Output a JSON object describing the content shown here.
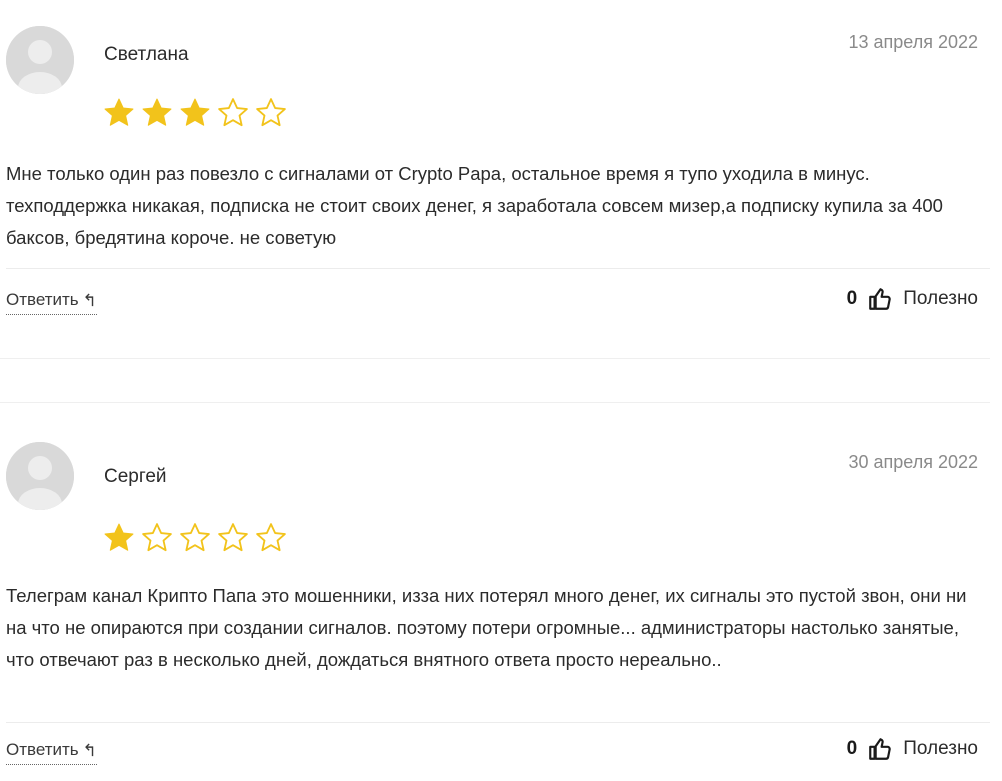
{
  "reviews": [
    {
      "author": "Светлана",
      "date": "13 апреля 2022",
      "rating": 3,
      "max_rating": 5,
      "text": "Мне только один раз повезло с сигналами от Crypto Papa, остальное время я тупо уходила в минус. техподдержка никакая, подписка не стоит своих денег, я заработала совсем мизер,а подписку купила за 400 баксов, бредятина короче. не советую",
      "reply_label": "Ответить",
      "helpful_count": "0",
      "helpful_label": "Полезно"
    },
    {
      "author": "Сергей",
      "date": "30 апреля 2022",
      "rating": 1,
      "max_rating": 5,
      "text": "Телеграм канал Крипто Папа это мошенники, изза них потерял много денег, их сигналы это пустой звон, они ни на что не опираются при создании сигналов. поэтому потери огромные... администраторы настолько занятые, что отвечают раз в несколько дней, дождаться внятного ответа просто нереально..",
      "reply_label": "Ответить",
      "helpful_count": "0",
      "helpful_label": "Полезно"
    }
  ],
  "icons": {
    "avatar": "user-avatar-placeholder-icon",
    "star_filled": "star-filled-icon",
    "star_empty": "star-outline-icon",
    "reply": "reply-arrow-icon",
    "thumb": "thumbs-up-icon"
  },
  "colors": {
    "star": "#f2c31b",
    "text": "#2b2b2b",
    "date": "#8a8a8a",
    "avatar_bg": "#d9d9d9"
  }
}
